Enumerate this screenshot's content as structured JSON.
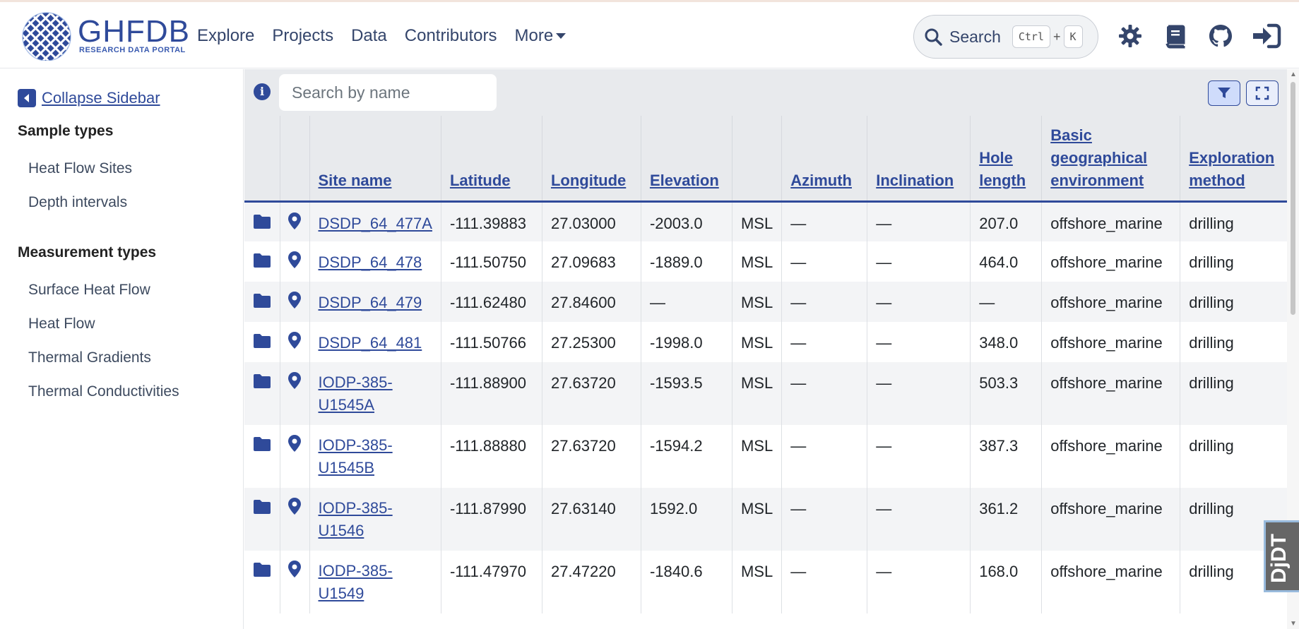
{
  "app": {
    "logo_title": "GHFDB",
    "logo_subtitle": "RESEARCH DATA PORTAL",
    "accent_color": "#2f4a9a"
  },
  "nav": {
    "items": [
      "Explore",
      "Projects",
      "Data",
      "Contributors",
      "More"
    ],
    "search_label": "Search",
    "search_kbd_1": "Ctrl",
    "search_kbd_plus": "+",
    "search_kbd_2": "K",
    "icons": [
      "theme-toggle-icon",
      "docs-book-icon",
      "github-icon",
      "login-icon"
    ]
  },
  "sidebar": {
    "collapse_label": "Collapse Sidebar",
    "sections": [
      {
        "heading": "Sample types",
        "items": [
          "Heat Flow Sites",
          "Depth intervals"
        ]
      },
      {
        "heading": "Measurement types",
        "items": [
          "Surface Heat Flow",
          "Heat Flow",
          "Thermal Gradients",
          "Thermal Conductivities"
        ]
      }
    ]
  },
  "table": {
    "search_placeholder": "Search by name",
    "columns": [
      "Site name",
      "Latitude",
      "Longitude",
      "Elevation",
      "",
      "Azimuth",
      "Inclination",
      "Hole length",
      "Basic geographical environment",
      "Exploration method"
    ],
    "rows": [
      [
        "DSDP_64_477A",
        "-111.39883",
        "27.03000",
        "-2003.0",
        "MSL",
        "—",
        "—",
        "207.0",
        "offshore_marine",
        "drilling"
      ],
      [
        "DSDP_64_478",
        "-111.50750",
        "27.09683",
        "-1889.0",
        "MSL",
        "—",
        "—",
        "464.0",
        "offshore_marine",
        "drilling"
      ],
      [
        "DSDP_64_479",
        "-111.62480",
        "27.84600",
        "—",
        "MSL",
        "—",
        "—",
        "—",
        "offshore_marine",
        "drilling"
      ],
      [
        "DSDP_64_481",
        "-111.50766",
        "27.25300",
        "-1998.0",
        "MSL",
        "—",
        "—",
        "348.0",
        "offshore_marine",
        "drilling"
      ],
      [
        "IODP-385-U1545A",
        "-111.88900",
        "27.63720",
        "-1593.5",
        "MSL",
        "—",
        "—",
        "503.3",
        "offshore_marine",
        "drilling"
      ],
      [
        "IODP-385-U1545B",
        "-111.88880",
        "27.63720",
        "-1594.2",
        "MSL",
        "—",
        "—",
        "387.3",
        "offshore_marine",
        "drilling"
      ],
      [
        "IODP-385-U1546",
        "-111.87990",
        "27.63140",
        "1592.0",
        "MSL",
        "—",
        "—",
        "361.2",
        "offshore_marine",
        "drilling"
      ],
      [
        "IODP-385-U1549",
        "-111.47970",
        "27.47220",
        "-1840.6",
        "MSL",
        "—",
        "—",
        "168.0",
        "offshore_marine",
        "drilling"
      ]
    ]
  },
  "debug_toolbar": {
    "label": "DjDT"
  }
}
